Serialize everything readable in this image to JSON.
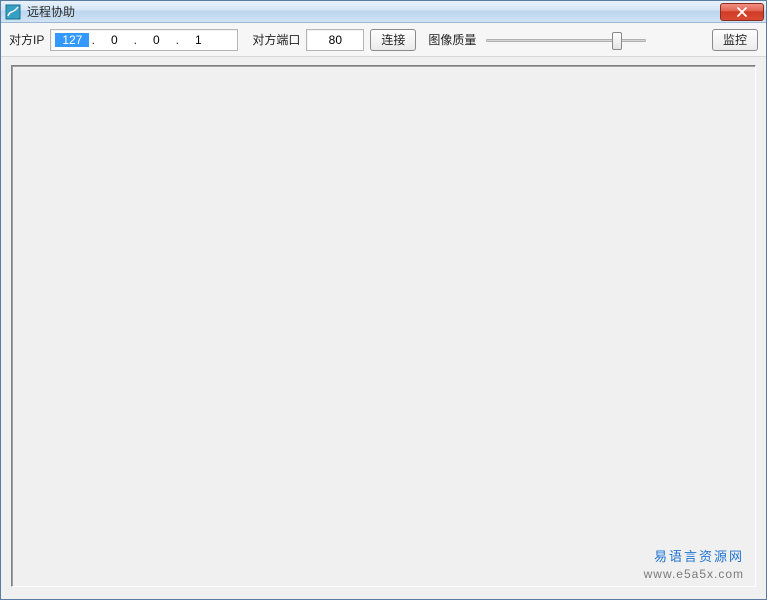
{
  "window": {
    "title": "远程协助"
  },
  "toolbar": {
    "ip_label": "对方IP",
    "ip": {
      "seg1": "127",
      "seg2": "0",
      "seg3": "0",
      "seg4": "1"
    },
    "port_label": "对方端口",
    "port_value": "80",
    "connect_label": "连接",
    "quality_label": "图像质量",
    "monitor_label": "监控"
  },
  "watermark": {
    "line1": "易语言资源网",
    "line2": "www.e5a5x.com"
  }
}
